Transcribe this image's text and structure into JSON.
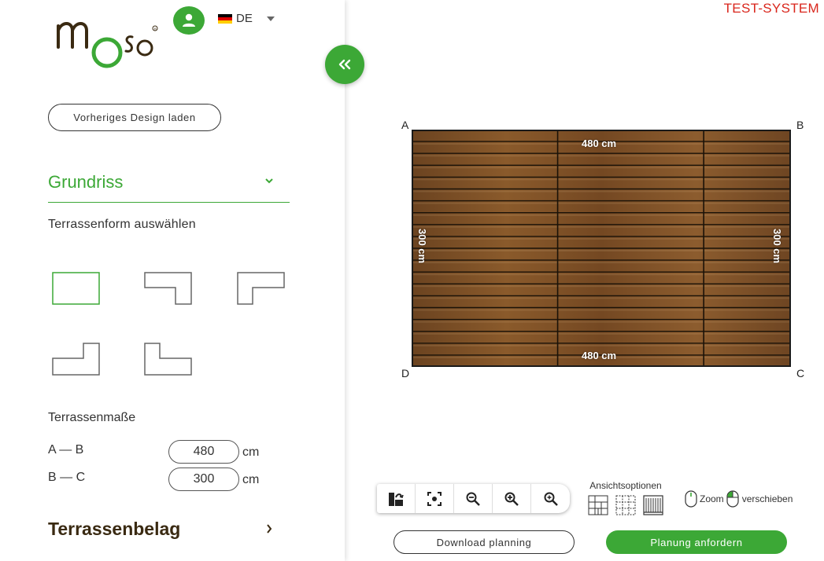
{
  "header": {
    "logo_text": "moso",
    "language": "DE",
    "flag_colors": [
      "#000000",
      "#dd0000",
      "#ffce00"
    ],
    "test_system_label": "TEST-SYSTEM"
  },
  "sidebar": {
    "prev_design_label": "Vorheriges Design laden",
    "grundriss_title": "Grundriss",
    "shape_label": "Terrassenform auswählen",
    "shapes": [
      "rectangle",
      "notch-bottom-left",
      "notch-bottom-right",
      "notch-top-left",
      "notch-top-right"
    ],
    "selected_shape": "rectangle",
    "dims_label": "Terrassenmaße",
    "dim_ab_label": "A — B",
    "dim_ab_value": "480",
    "dim_bc_label": "B — C",
    "dim_bc_value": "300",
    "unit": "cm",
    "terrassenbelag_title": "Terrassenbelag"
  },
  "canvas": {
    "corners": {
      "a": "A",
      "b": "B",
      "c": "C",
      "d": "D"
    },
    "measure_top": "480 cm",
    "measure_bottom": "480 cm",
    "measure_left": "300 cm",
    "measure_right": "300 cm",
    "board_rows": 20,
    "seam_positions_fraction": [
      0.385,
      0.77
    ]
  },
  "toolbar": {
    "tools": [
      "reset-layout-icon",
      "fit-to-screen-icon",
      "zoom-out-icon",
      "zoom-in-icon",
      "zoom-area-icon"
    ]
  },
  "view_options": {
    "label": "Ansichtsoptionen",
    "icons": [
      "view-substructure-icon",
      "view-grid-icon",
      "view-boards-icon"
    ]
  },
  "mouse_help": {
    "zoom_label": "Zoom",
    "move_label": "verschieben"
  },
  "footer": {
    "download_label": "Download planning",
    "request_label": "Planung anfordern"
  },
  "colors": {
    "accent": "#3ca836",
    "test_system": "#d9261c",
    "wood_dark": "#6b4320",
    "wood_light": "#8a5a2b"
  }
}
